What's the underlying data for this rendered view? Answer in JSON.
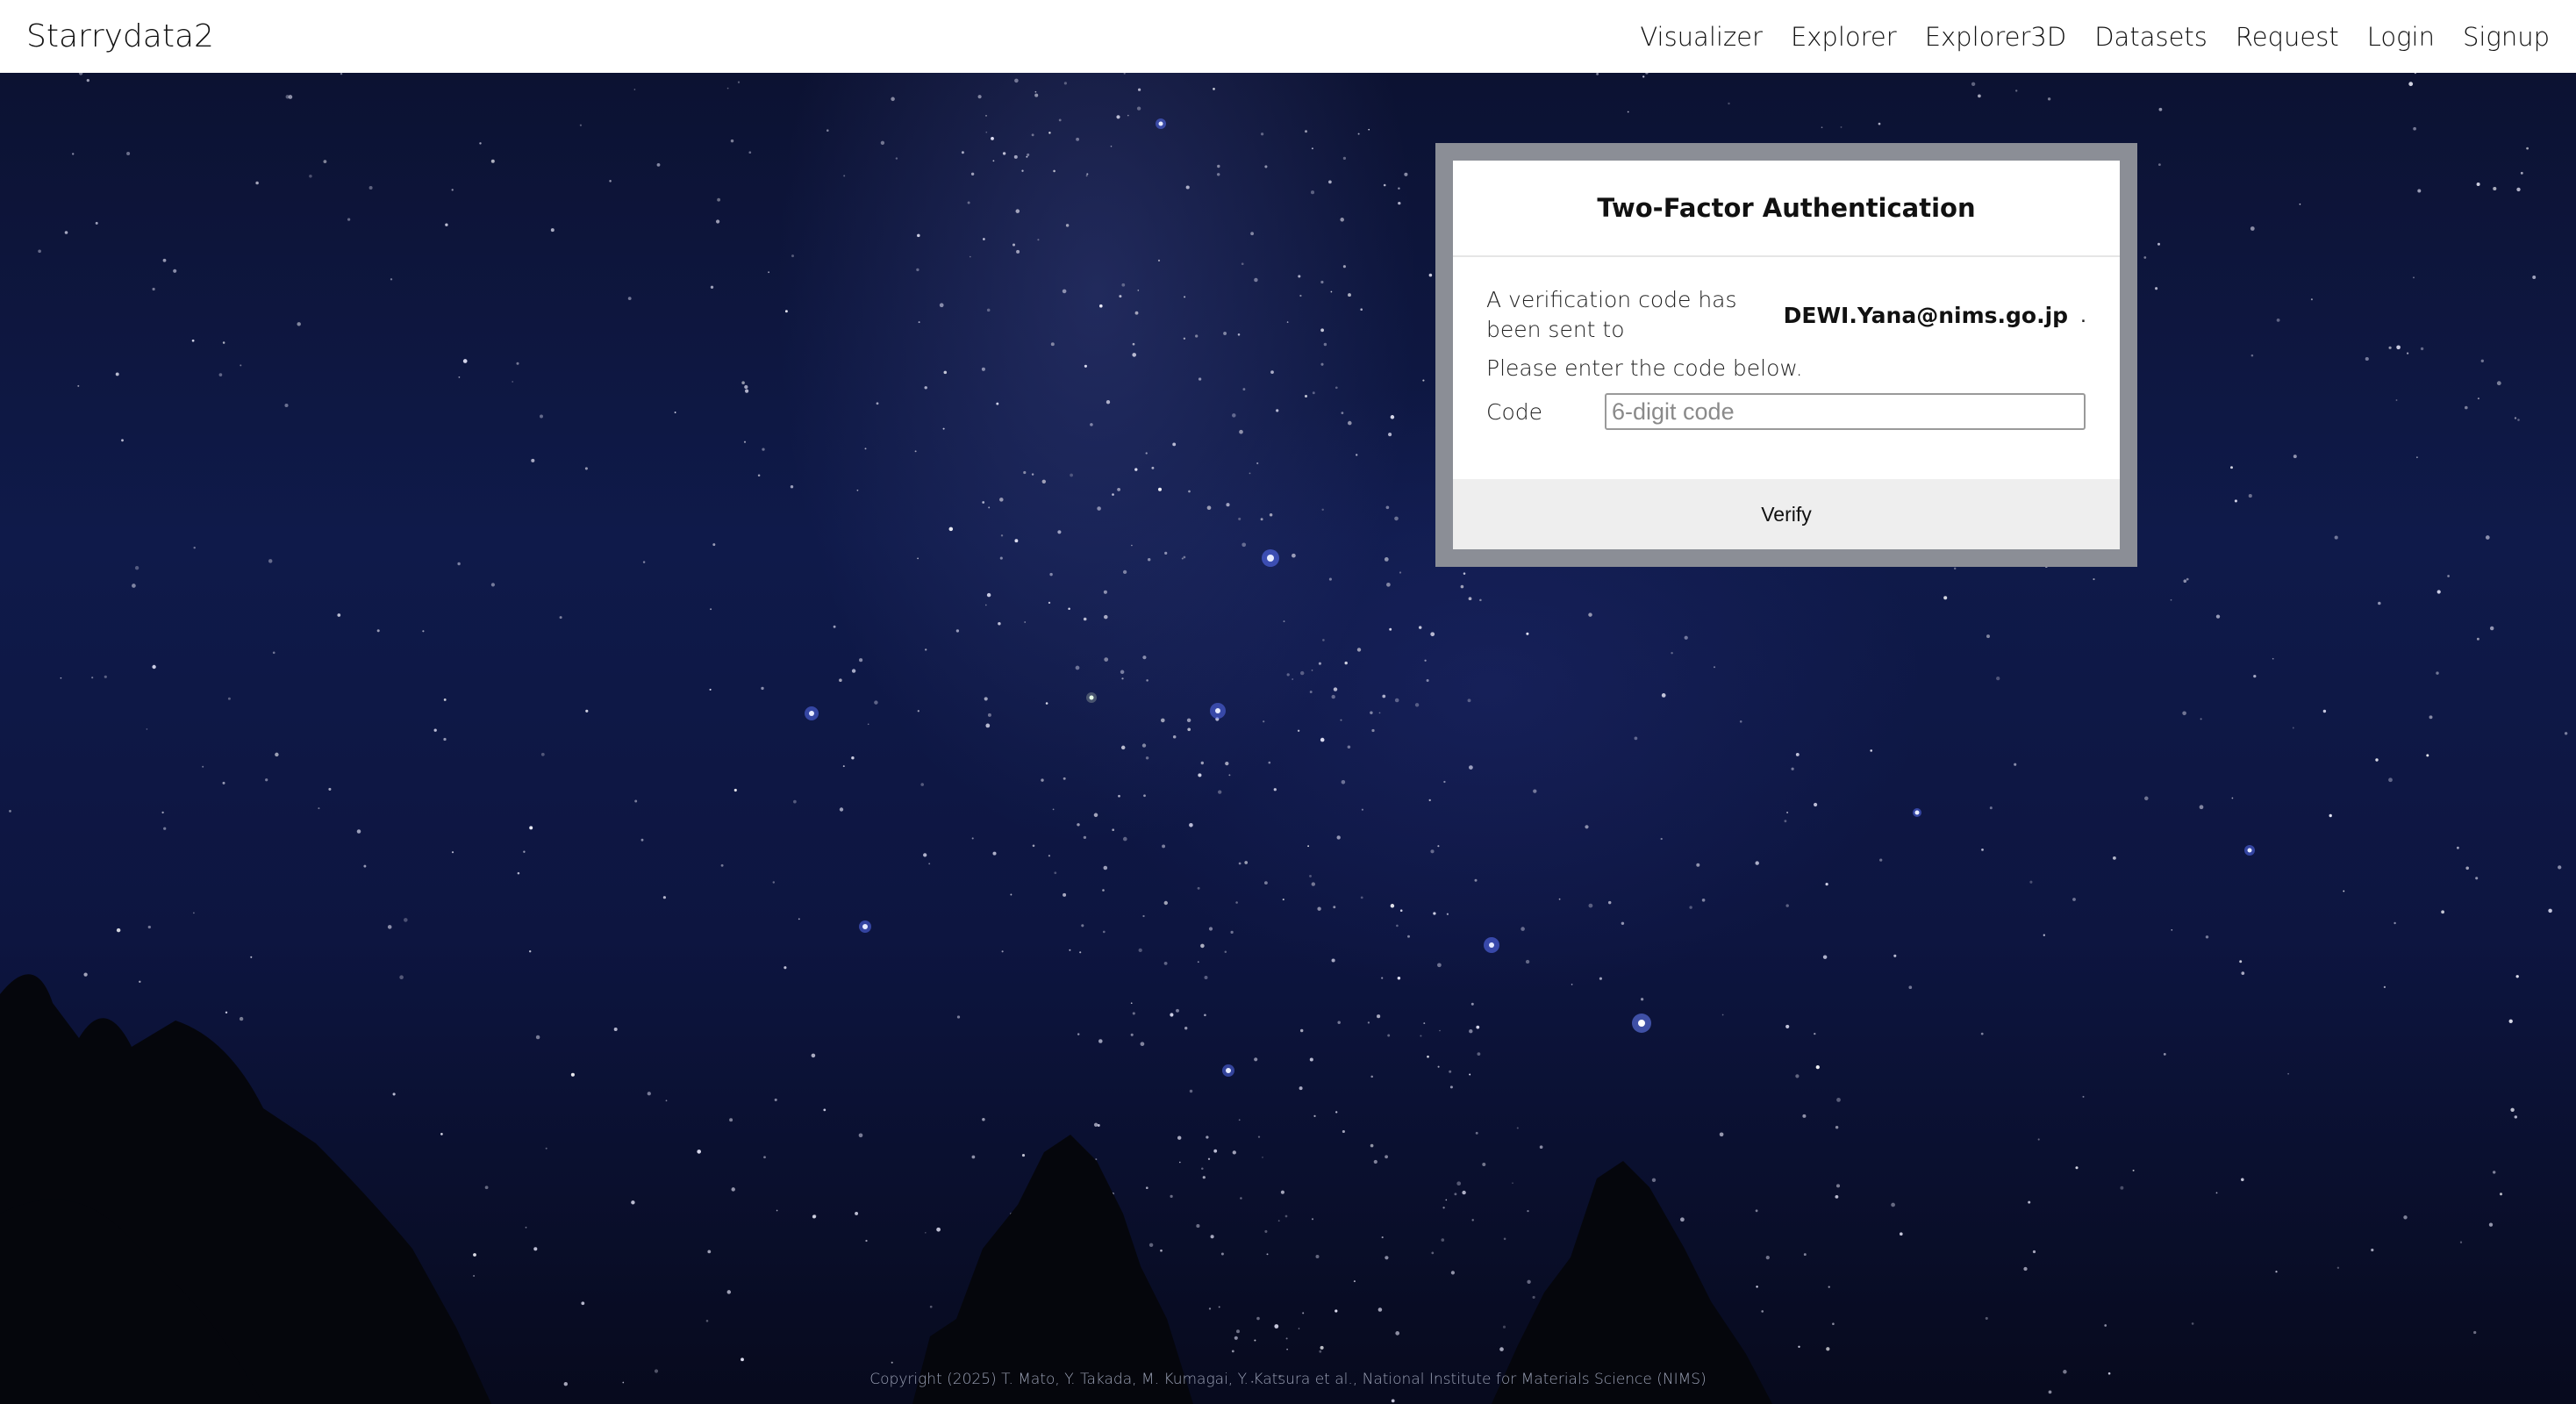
{
  "nav": {
    "brand": "Starrydata2",
    "links": [
      "Visualizer",
      "Explorer",
      "Explorer3D",
      "Datasets",
      "Request",
      "Login",
      "Signup"
    ]
  },
  "dialog": {
    "title": "Two-Factor Authentication",
    "message": "A verification code has been sent to",
    "email": "DEWI.Yana@nims.go.jp",
    "message_end": ".",
    "instruction": "Please enter the code below.",
    "code_label": "Code",
    "code_placeholder": "6-digit code",
    "code_value": "",
    "verify_label": "Verify"
  },
  "footer": {
    "copyright": "Copyright (2025) T. Mato, Y. Takada, M. Kumagai, Y. Katsura et al., National Institute for Materials Science (NIMS)"
  },
  "colors": {
    "dialog_frame": "#8b8e96",
    "dialog_footer": "#eeeeee",
    "sky_dark": "#070a1d",
    "sky_blue": "#0f1a4a"
  }
}
